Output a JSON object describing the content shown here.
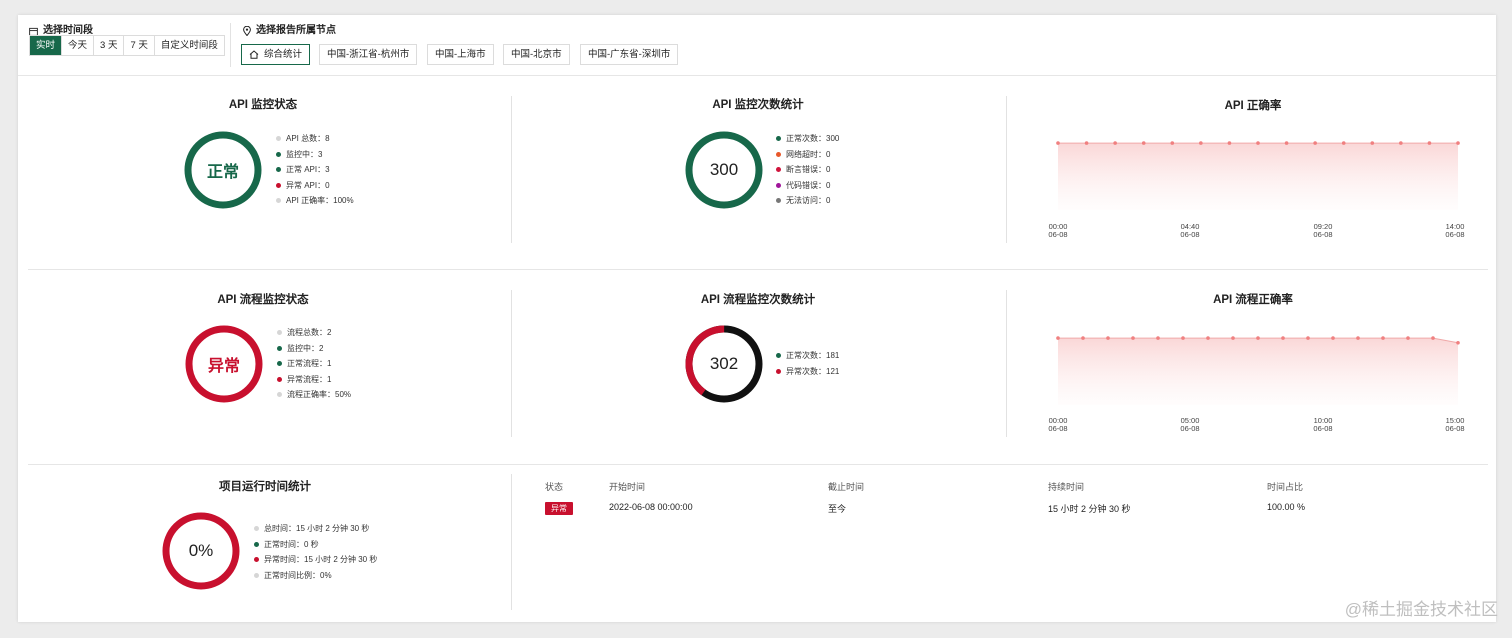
{
  "filters": {
    "time_label": "选择时间段",
    "time_options": [
      "实时",
      "今天",
      "3 天",
      "7 天",
      "自定义时间段"
    ],
    "time_selected": "实时",
    "node_label": "选择报告所属节点",
    "nodes": [
      "综合统计",
      "中国-浙江省-杭州市",
      "中国-上海市",
      "中国-北京市",
      "中国-广东省-深圳市"
    ],
    "node_selected": "综合统计"
  },
  "colors": {
    "green": "#17684a",
    "red": "#c8102e",
    "orange": "#e8582a",
    "crimson": "#d0143c",
    "purple": "#a0169a",
    "gray": "#777777",
    "lightgray": "#d6d6d6",
    "black": "#111111",
    "line": "#f0a8a8"
  },
  "api_status": {
    "title": "API 监控状态",
    "center": "正常",
    "legend": [
      "API 总数：8",
      "监控中：3",
      "正常 API：3",
      "异常 API：0",
      "API 正确率：100%"
    ]
  },
  "api_count": {
    "title": "API 监控次数统计",
    "center": "300",
    "legend": [
      "正常次数：300",
      "网络超时：0",
      "断言错误：0",
      "代码错误：0",
      "无法访问：0"
    ]
  },
  "api_accuracy": {
    "title": "API 正确率",
    "ticks": [
      {
        "time": "00:00",
        "date": "06-08"
      },
      {
        "time": "04:40",
        "date": "06-08"
      },
      {
        "time": "09:20",
        "date": "06-08"
      },
      {
        "time": "14:00",
        "date": "06-08"
      }
    ]
  },
  "flow_status": {
    "title": "API 流程监控状态",
    "center": "异常",
    "legend": [
      "流程总数：2",
      "监控中：2",
      "正常流程：1",
      "异常流程：1",
      "流程正确率：50%"
    ]
  },
  "flow_count": {
    "title": "API 流程监控次数统计",
    "center": "302",
    "legend": [
      "正常次数：181",
      "异常次数：121"
    ]
  },
  "flow_accuracy": {
    "title": "API 流程正确率",
    "ticks": [
      {
        "time": "00:00",
        "date": "06-08"
      },
      {
        "time": "05:00",
        "date": "06-08"
      },
      {
        "time": "10:00",
        "date": "06-08"
      },
      {
        "time": "15:00",
        "date": "06-08"
      }
    ]
  },
  "runtime": {
    "title": "项目运行时间统计",
    "center": "0%",
    "legend": [
      "总时间：15 小时 2 分钟 30 秒",
      "正常时间：0 秒",
      "异常时间：15 小时 2 分钟 30 秒",
      "正常时间比例：0%"
    ]
  },
  "table": {
    "headers": [
      "状态",
      "开始时间",
      "截止时间",
      "持续时间",
      "时间占比"
    ],
    "row": {
      "status": "异常",
      "start": "2022-06-08 00:00:00",
      "end": "至今",
      "duration": "15 小时 2 分钟 30 秒",
      "ratio": "100.00 %"
    }
  },
  "watermark": "@稀土掘金技术社区",
  "chart_data": [
    {
      "type": "area",
      "title": "API 正确率",
      "x": [
        "00:00 06-08",
        "04:40 06-08",
        "09:20 06-08",
        "14:00 06-08"
      ],
      "series": [
        {
          "values": [
            1,
            1,
            1,
            1,
            1,
            1,
            1,
            1,
            1,
            1,
            1,
            1,
            1,
            1,
            1
          ]
        }
      ],
      "ylim": [
        0,
        1.3
      ],
      "grid": false
    },
    {
      "type": "area",
      "title": "API 流程正确率",
      "x": [
        "00:00 06-08",
        "05:00 06-08",
        "10:00 06-08",
        "15:00 06-08"
      ],
      "series": [
        {
          "values": [
            1,
            1,
            1,
            1,
            1,
            1,
            1,
            1,
            1,
            1,
            1,
            1,
            1,
            1,
            1,
            1,
            0.93
          ]
        }
      ],
      "ylim": [
        0,
        1.3
      ],
      "grid": false
    }
  ]
}
